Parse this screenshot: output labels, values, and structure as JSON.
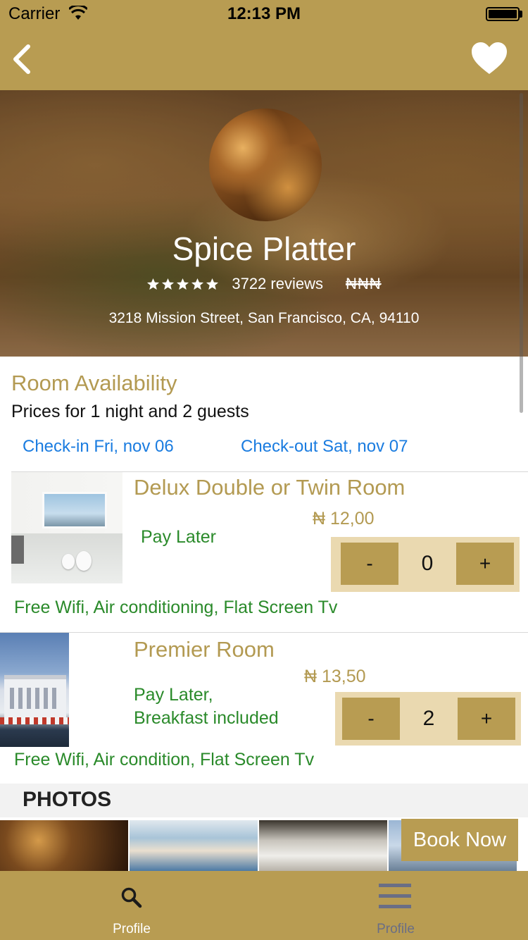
{
  "status_bar": {
    "carrier": "Carrier",
    "time": "12:13 PM"
  },
  "nav": {
    "back_icon": "chevron-left-icon",
    "favorite_icon": "heart-icon"
  },
  "restaurant": {
    "name": "Spice Platter",
    "rating_stars": 5,
    "reviews": "3722 reviews",
    "price_level": "₦₦₦",
    "address": "3218 Mission Street, San Francisco, CA, 94110"
  },
  "availability": {
    "title": "Room Availability",
    "subtitle": "Prices for 1 night and 2 guests",
    "checkin": "Check-in Fri, nov 06",
    "checkout": "Check-out Sat, nov 07"
  },
  "rooms": [
    {
      "title": "Delux Double or Twin Room",
      "price": "₦ 12,00",
      "payment": "Pay Later",
      "quantity": "0",
      "decrement_label": "-",
      "increment_label": "+",
      "amenities": "Free Wifi, Air conditioning, Flat Screen Tv"
    },
    {
      "title": "Premier Room",
      "price": "₦ 13,50",
      "payment_line1": "Pay Later,",
      "payment_line2": "Breakfast included",
      "quantity": "2",
      "decrement_label": "-",
      "increment_label": "+",
      "amenities": "Free Wifi, Air condition, Flat Screen Tv"
    }
  ],
  "photos": {
    "title": "PHOTOS"
  },
  "book_now_label": "Book Now",
  "tab_bar": {
    "tabs": [
      {
        "label": "Profile",
        "icon": "search-icon",
        "active": true
      },
      {
        "label": "Profile",
        "icon": "menu-icon",
        "active": false
      }
    ]
  },
  "colors": {
    "brand_gold": "#b89c52",
    "title_gold": "#b39a52",
    "link_blue": "#1a7ce0",
    "green_text": "#2a8a2a",
    "stepper_bg": "#ead9b0"
  }
}
